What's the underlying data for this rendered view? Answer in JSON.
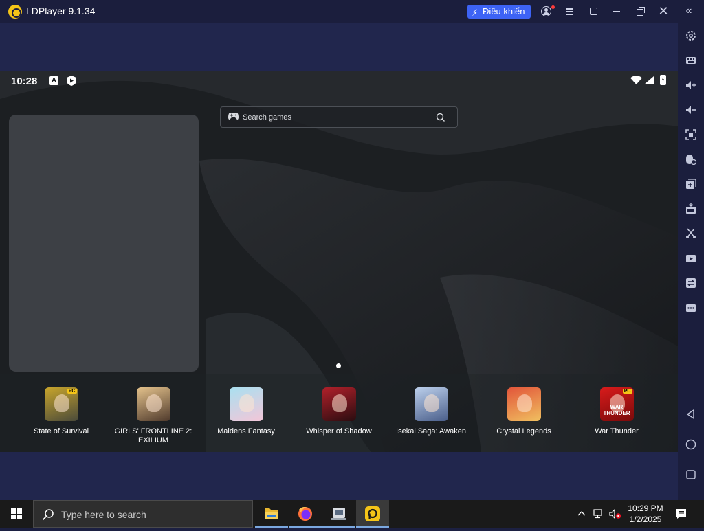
{
  "window": {
    "title": "LDPlayer 9.1.34",
    "control_button_label": "Điều khiển"
  },
  "status_bar": {
    "time": "10:28",
    "a_badge": "A"
  },
  "search": {
    "label": "Search games"
  },
  "home": {
    "page_count": 1,
    "active_page": 1
  },
  "apps": [
    {
      "label": "State of Survival",
      "pc_badge": "PC",
      "colors": [
        "#c8a52c",
        "#4a4a3a"
      ]
    },
    {
      "label": "GIRLS' FRONTLINE 2: EXILIUM",
      "pc_badge": "",
      "colors": [
        "#e3c18b",
        "#4f3a2c"
      ]
    },
    {
      "label": "Maidens Fantasy",
      "pc_badge": "",
      "colors": [
        "#a9e0f0",
        "#f3c6d8"
      ]
    },
    {
      "label": "Whisper of Shadow",
      "pc_badge": "",
      "colors": [
        "#b0202a",
        "#2a0d10"
      ]
    },
    {
      "label": "Isekai Saga: Awaken",
      "pc_badge": "",
      "colors": [
        "#bcd0ec",
        "#4a5e8a"
      ]
    },
    {
      "label": "Crystal Legends",
      "pc_badge": "",
      "colors": [
        "#e2553a",
        "#f0c060"
      ]
    },
    {
      "label": "War Thunder",
      "pc_badge": "PC",
      "colors": [
        "#d81b1b",
        "#7a0a0a"
      ],
      "tile_text": "WAR THUNDER"
    }
  ],
  "sidebar_icons": [
    "settings-gear-icon",
    "keyboard-icon",
    "volume-up-icon",
    "volume-down-icon",
    "fullscreen-icon",
    "mouse-lock-icon",
    "add-window-icon",
    "apk-install-icon",
    "scissors-icon",
    "record-video-icon",
    "sync-icon",
    "more-icon",
    "back-nav-icon",
    "home-nav-icon",
    "recents-nav-icon"
  ],
  "taskbar": {
    "search_placeholder": "Type here to search",
    "time": "10:29 PM",
    "date": "1/2/2025"
  }
}
